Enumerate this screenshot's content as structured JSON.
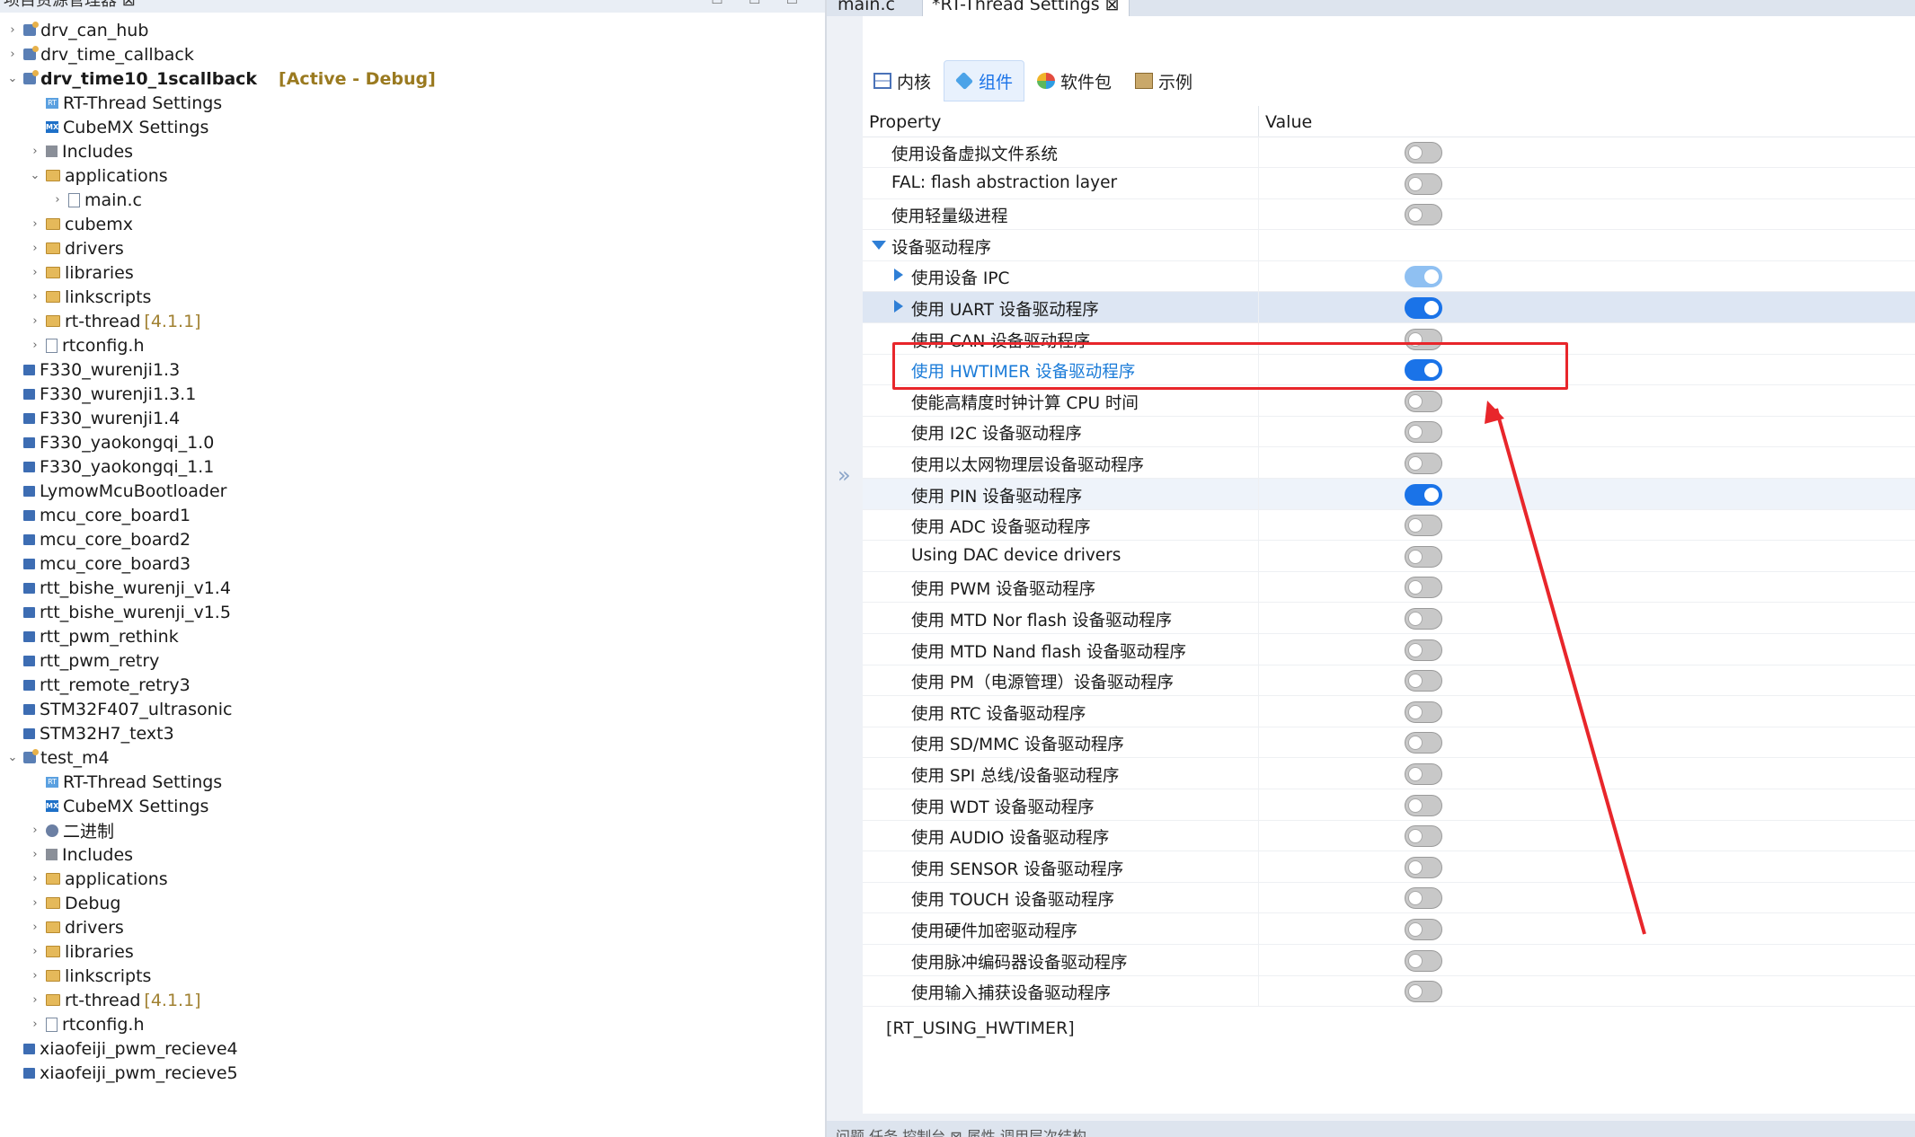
{
  "explorer": {
    "title": "项目资源管理器 ⊠",
    "tree": [
      {
        "label": "drv_can_hub",
        "indent": 0,
        "chev": "›",
        "icon": "project-icon"
      },
      {
        "label": "drv_time_callback",
        "indent": 0,
        "chev": "›",
        "icon": "project-icon"
      },
      {
        "label": "drv_time10_1scallback",
        "indent": 0,
        "chev": "⌄",
        "icon": "project-icon",
        "bold": true,
        "tag": "[Active - Debug]"
      },
      {
        "label": "RT-Thread Settings",
        "indent": 1,
        "chev": "",
        "icon": "rt-icon"
      },
      {
        "label": "CubeMX Settings",
        "indent": 1,
        "chev": "",
        "icon": "mx-icon"
      },
      {
        "label": "Includes",
        "indent": 1,
        "chev": "›",
        "icon": "includes-icon"
      },
      {
        "label": "applications",
        "indent": 1,
        "chev": "⌄",
        "icon": "folder-icon"
      },
      {
        "label": "main.c",
        "indent": 2,
        "chev": "›",
        "icon": "file-icon"
      },
      {
        "label": "cubemx",
        "indent": 1,
        "chev": "›",
        "icon": "folder-icon"
      },
      {
        "label": "drivers",
        "indent": 1,
        "chev": "›",
        "icon": "folder-icon"
      },
      {
        "label": "libraries",
        "indent": 1,
        "chev": "›",
        "icon": "folder-icon"
      },
      {
        "label": "linkscripts",
        "indent": 1,
        "chev": "›",
        "icon": "folder-icon"
      },
      {
        "label": "rt-thread",
        "indent": 1,
        "chev": "›",
        "icon": "folder-icon",
        "ver": "[4.1.1]"
      },
      {
        "label": "rtconfig.h",
        "indent": 1,
        "chev": "›",
        "icon": "file-icon"
      },
      {
        "label": "F330_wurenji1.3",
        "indent": 0,
        "chev": "",
        "icon": "closed-project-icon"
      },
      {
        "label": "F330_wurenji1.3.1",
        "indent": 0,
        "chev": "",
        "icon": "closed-project-icon"
      },
      {
        "label": "F330_wurenji1.4",
        "indent": 0,
        "chev": "",
        "icon": "closed-project-icon"
      },
      {
        "label": "F330_yaokongqi_1.0",
        "indent": 0,
        "chev": "",
        "icon": "closed-project-icon"
      },
      {
        "label": "F330_yaokongqi_1.1",
        "indent": 0,
        "chev": "",
        "icon": "closed-project-icon"
      },
      {
        "label": "LymowMcuBootloader",
        "indent": 0,
        "chev": "",
        "icon": "closed-project-icon"
      },
      {
        "label": "mcu_core_board1",
        "indent": 0,
        "chev": "",
        "icon": "closed-project-icon"
      },
      {
        "label": "mcu_core_board2",
        "indent": 0,
        "chev": "",
        "icon": "closed-project-icon"
      },
      {
        "label": "mcu_core_board3",
        "indent": 0,
        "chev": "",
        "icon": "closed-project-icon"
      },
      {
        "label": "rtt_bishe_wurenji_v1.4",
        "indent": 0,
        "chev": "",
        "icon": "closed-project-icon"
      },
      {
        "label": "rtt_bishe_wurenji_v1.5",
        "indent": 0,
        "chev": "",
        "icon": "closed-project-icon"
      },
      {
        "label": "rtt_pwm_rethink",
        "indent": 0,
        "chev": "",
        "icon": "closed-project-icon"
      },
      {
        "label": "rtt_pwm_retry",
        "indent": 0,
        "chev": "",
        "icon": "closed-project-icon"
      },
      {
        "label": "rtt_remote_retry3",
        "indent": 0,
        "chev": "",
        "icon": "closed-project-icon"
      },
      {
        "label": "STM32F407_ultrasonic",
        "indent": 0,
        "chev": "",
        "icon": "closed-project-icon"
      },
      {
        "label": "STM32H7_text3",
        "indent": 0,
        "chev": "",
        "icon": "closed-project-icon"
      },
      {
        "label": "test_m4",
        "indent": 0,
        "chev": "⌄",
        "icon": "project-icon"
      },
      {
        "label": "RT-Thread Settings",
        "indent": 1,
        "chev": "",
        "icon": "rt-icon"
      },
      {
        "label": "CubeMX Settings",
        "indent": 1,
        "chev": "",
        "icon": "mx-icon"
      },
      {
        "label": "二进制",
        "indent": 1,
        "chev": "›",
        "icon": "binaries-icon"
      },
      {
        "label": "Includes",
        "indent": 1,
        "chev": "›",
        "icon": "includes-icon"
      },
      {
        "label": "applications",
        "indent": 1,
        "chev": "›",
        "icon": "folder-icon"
      },
      {
        "label": "Debug",
        "indent": 1,
        "chev": "›",
        "icon": "folder-icon"
      },
      {
        "label": "drivers",
        "indent": 1,
        "chev": "›",
        "icon": "folder-icon"
      },
      {
        "label": "libraries",
        "indent": 1,
        "chev": "›",
        "icon": "folder-icon"
      },
      {
        "label": "linkscripts",
        "indent": 1,
        "chev": "›",
        "icon": "folder-icon"
      },
      {
        "label": "rt-thread",
        "indent": 1,
        "chev": "›",
        "icon": "folder-icon",
        "ver": "[4.1.1]"
      },
      {
        "label": "rtconfig.h",
        "indent": 1,
        "chev": "›",
        "icon": "file-icon"
      },
      {
        "label": "xiaofeiji_pwm_recieve4",
        "indent": 0,
        "chev": "",
        "icon": "closed-project-icon"
      },
      {
        "label": "xiaofeiji_pwm_recieve5",
        "indent": 0,
        "chev": "",
        "icon": "closed-project-icon"
      }
    ]
  },
  "editor_tabs": [
    {
      "label": "main.c",
      "active": false
    },
    {
      "label": "*RT-Thread Settings ⊠",
      "active": true
    }
  ],
  "subtabs": [
    {
      "label": "内核",
      "icon": "kernel-icon",
      "active": false
    },
    {
      "label": "组件",
      "icon": "component-icon",
      "active": true
    },
    {
      "label": "软件包",
      "icon": "package-icon",
      "active": false
    },
    {
      "label": "示例",
      "icon": "sample-icon",
      "active": false
    }
  ],
  "table": {
    "col_property": "Property",
    "col_value": "Value",
    "rows": [
      {
        "label": "使用设备虚拟文件系统",
        "level": 0,
        "exp": "",
        "state": "off"
      },
      {
        "label": "FAL: flash abstraction layer",
        "level": 0,
        "exp": "",
        "state": "off"
      },
      {
        "label": "使用轻量级进程",
        "level": 0,
        "exp": "",
        "state": "off"
      },
      {
        "label": "设备驱动程序",
        "level": 0,
        "exp": "down",
        "state": "none"
      },
      {
        "label": "使用设备 IPC",
        "level": 1,
        "exp": "right",
        "state": "disabled-on"
      },
      {
        "label": "使用 UART 设备驱动程序",
        "level": 1,
        "exp": "right",
        "state": "on",
        "row": "selected"
      },
      {
        "label": "使用 CAN 设备驱动程序",
        "level": 1,
        "exp": "",
        "state": "off"
      },
      {
        "label": "使用 HWTIMER 设备驱动程序",
        "level": 1,
        "exp": "",
        "state": "on",
        "highlight": true
      },
      {
        "label": "使能高精度时钟计算 CPU 时间",
        "level": 1,
        "exp": "",
        "state": "off"
      },
      {
        "label": "使用 I2C 设备驱动程序",
        "level": 1,
        "exp": "",
        "state": "off"
      },
      {
        "label": "使用以太网物理层设备驱动程序",
        "level": 1,
        "exp": "",
        "state": "off"
      },
      {
        "label": "使用 PIN 设备驱动程序",
        "level": 1,
        "exp": "",
        "state": "on",
        "row": "hover"
      },
      {
        "label": "使用 ADC 设备驱动程序",
        "level": 1,
        "exp": "",
        "state": "off"
      },
      {
        "label": "Using DAC device drivers",
        "level": 1,
        "exp": "",
        "state": "off"
      },
      {
        "label": "使用 PWM 设备驱动程序",
        "level": 1,
        "exp": "",
        "state": "off"
      },
      {
        "label": "使用 MTD Nor flash 设备驱动程序",
        "level": 1,
        "exp": "",
        "state": "off"
      },
      {
        "label": "使用 MTD Nand flash 设备驱动程序",
        "level": 1,
        "exp": "",
        "state": "off"
      },
      {
        "label": "使用 PM（电源管理）设备驱动程序",
        "level": 1,
        "exp": "",
        "state": "off"
      },
      {
        "label": "使用 RTC 设备驱动程序",
        "level": 1,
        "exp": "",
        "state": "off"
      },
      {
        "label": "使用 SD/MMC 设备驱动程序",
        "level": 1,
        "exp": "",
        "state": "off"
      },
      {
        "label": "使用 SPI 总线/设备驱动程序",
        "level": 1,
        "exp": "",
        "state": "off"
      },
      {
        "label": "使用 WDT 设备驱动程序",
        "level": 1,
        "exp": "",
        "state": "off"
      },
      {
        "label": "使用 AUDIO 设备驱动程序",
        "level": 1,
        "exp": "",
        "state": "off"
      },
      {
        "label": "使用 SENSOR 设备驱动程序",
        "level": 1,
        "exp": "",
        "state": "off"
      },
      {
        "label": "使用 TOUCH 设备驱动程序",
        "level": 1,
        "exp": "",
        "state": "off"
      },
      {
        "label": "使用硬件加密驱动程序",
        "level": 1,
        "exp": "",
        "state": "off"
      },
      {
        "label": "使用脉冲编码器设备驱动程序",
        "level": 1,
        "exp": "",
        "state": "off"
      },
      {
        "label": "使用输入捕获设备驱动程序",
        "level": 1,
        "exp": "",
        "state": "off"
      }
    ]
  },
  "macro_text": "[RT_USING_HWTIMER]",
  "footer_tabs": "问题  任务  控制台 ⊠  属性  调用层次结构",
  "colors": {
    "accent": "#1a73e8",
    "annotation": "#e8262b"
  }
}
